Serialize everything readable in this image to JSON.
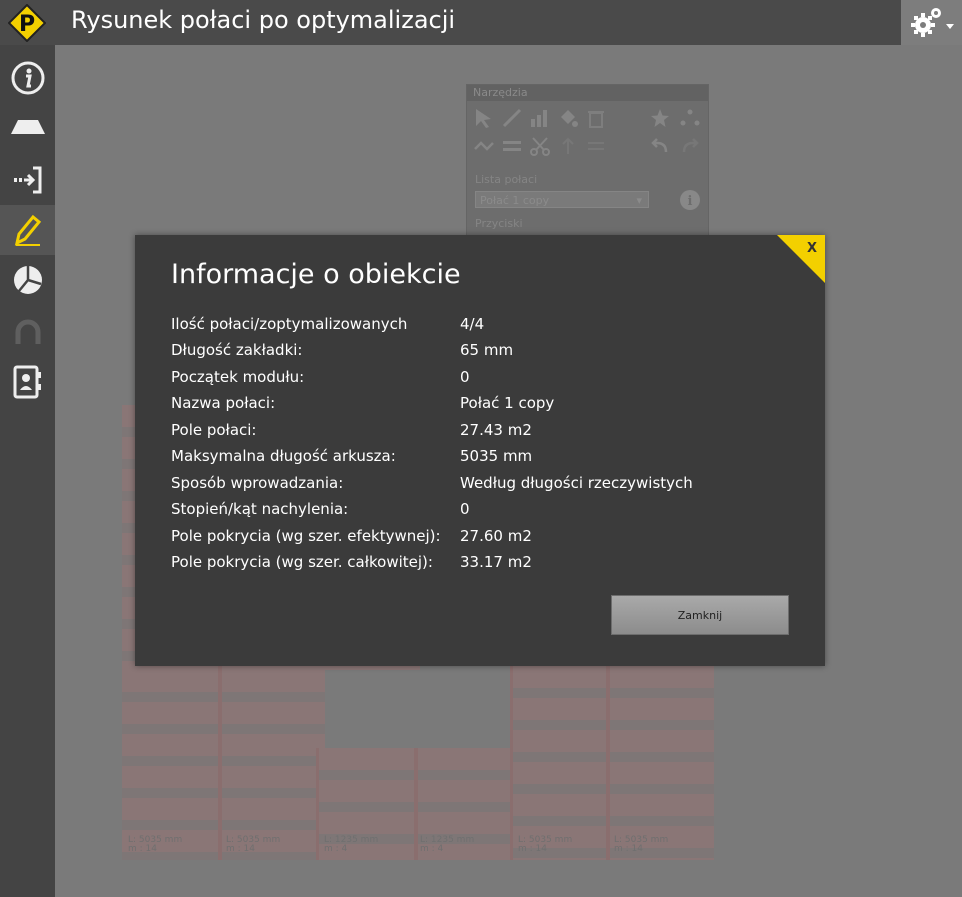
{
  "app": {
    "title": "Rysunek połaci po optymalizacji",
    "logo_letter": "P",
    "accent": "#f3d000"
  },
  "sidebar": {
    "items": [
      {
        "icon": "info-icon"
      },
      {
        "icon": "roof-icon"
      },
      {
        "icon": "import-icon"
      },
      {
        "icon": "pencil-icon",
        "active": true
      },
      {
        "icon": "pie-chart-icon"
      },
      {
        "icon": "magnet-icon"
      },
      {
        "icon": "contact-card-icon"
      }
    ]
  },
  "tools": {
    "title": "Narzędzia",
    "list_label": "Lista połaci",
    "list_value": "Połać 1 copy",
    "second_label": "Przyciski"
  },
  "drawing": {
    "sheets": [
      {
        "l1": "L: 5035 mm",
        "l2": "m : 14"
      },
      {
        "l1": "L: 5035 mm",
        "l2": "m : 14"
      },
      {
        "l1": "L: 1235 mm",
        "l2": "m : 4"
      },
      {
        "l1": "L: 1235 mm",
        "l2": "m : 4"
      },
      {
        "l1": "L: 5035 mm",
        "l2": "m : 14"
      },
      {
        "l1": "L: 5035 mm",
        "l2": "m : 14"
      }
    ]
  },
  "dialog": {
    "title": "Informacje o obiekcie",
    "close_label": "X",
    "rows": [
      {
        "label": "Ilość połaci/zoptymalizowanych",
        "value": "4/4"
      },
      {
        "label": "Długość zakładki:",
        "value": "65 mm"
      },
      {
        "label": "Początek modułu:",
        "value": "0"
      },
      {
        "label": "Nazwa połaci:",
        "value": "Połać 1 copy"
      },
      {
        "label": "Pole połaci:",
        "value": "27.43 m2"
      },
      {
        "label": "Maksymalna długość arkusza:",
        "value": "5035 mm"
      },
      {
        "label": "Sposób wprowadzania:",
        "value": "Według długości rzeczywistych"
      },
      {
        "label": "Stopień/kąt nachylenia:",
        "value": "0"
      },
      {
        "label": "Pole pokrycia (wg szer. efektywnej):",
        "value": "27.60 m2"
      },
      {
        "label": "Pole pokrycia (wg szer. całkowitej):",
        "value": "33.17 m2"
      }
    ],
    "button_label": "Zamknij"
  }
}
